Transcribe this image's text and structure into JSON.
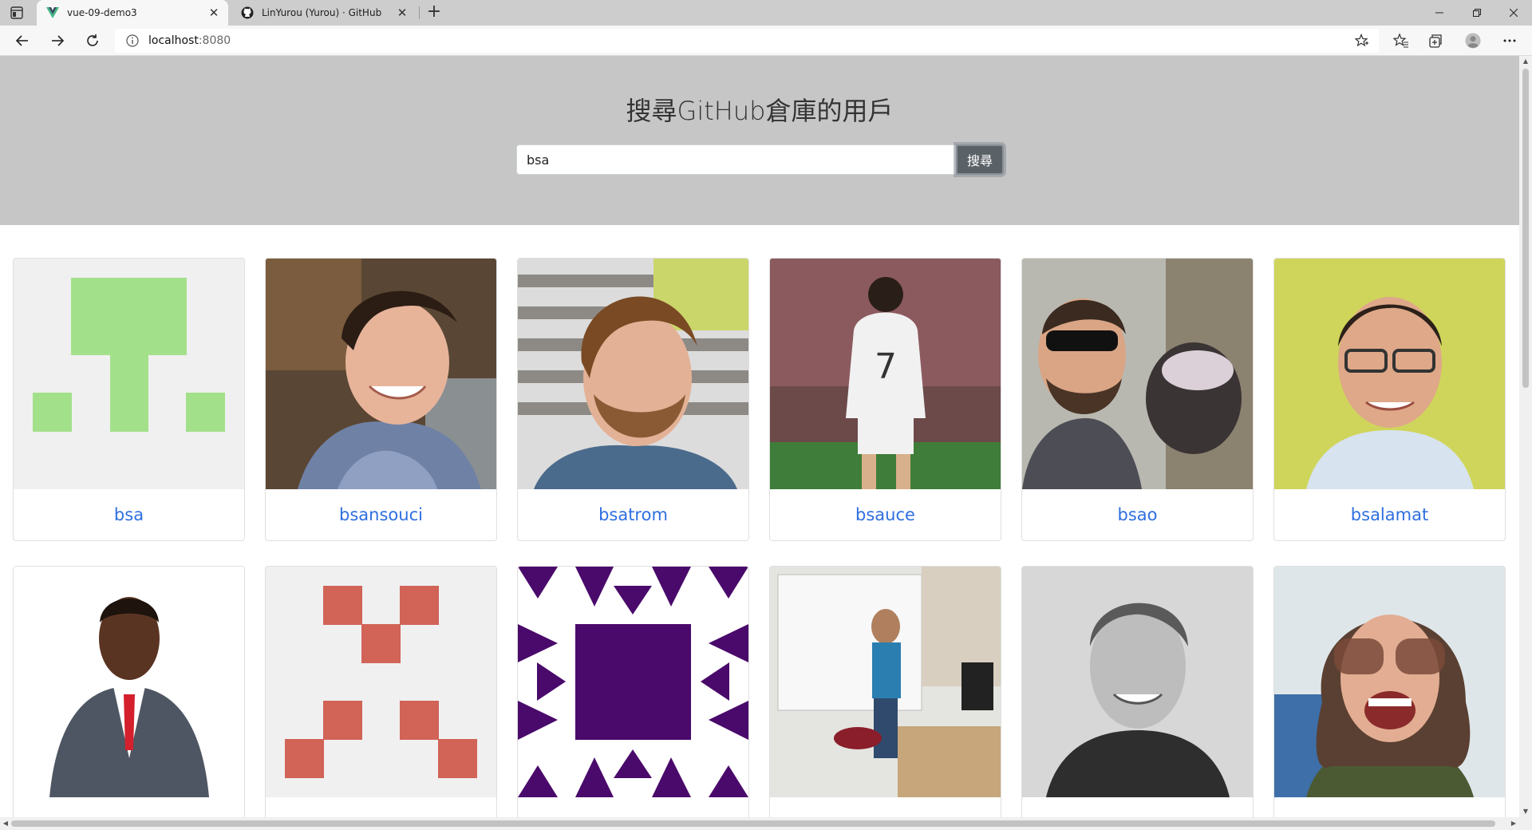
{
  "browser": {
    "tabs": [
      {
        "title": "vue-09-demo3",
        "favicon": "vue-logo-icon",
        "active": true
      },
      {
        "title": "LinYurou (Yurou) · GitHub",
        "favicon": "github-icon",
        "active": false
      }
    ],
    "url_host": "localhost",
    "url_port": ":8080"
  },
  "page": {
    "title": "搜尋GitHub倉庫的用戶",
    "search": {
      "value": "bsa",
      "button_label": "搜尋"
    }
  },
  "users": [
    {
      "login": "bsa",
      "avatar": "identicon-green"
    },
    {
      "login": "bsansouci",
      "avatar": "photo"
    },
    {
      "login": "bsatrom",
      "avatar": "photo"
    },
    {
      "login": "bsauce",
      "avatar": "photo"
    },
    {
      "login": "bsao",
      "avatar": "photo"
    },
    {
      "login": "bsalamat",
      "avatar": "photo"
    },
    {
      "login": "",
      "avatar": "photo"
    },
    {
      "login": "",
      "avatar": "identicon-red"
    },
    {
      "login": "",
      "avatar": "identicon-purple"
    },
    {
      "login": "",
      "avatar": "photo"
    },
    {
      "login": "",
      "avatar": "photo"
    },
    {
      "login": "",
      "avatar": "photo"
    }
  ],
  "colors": {
    "jumbotron": "#c6c6c6",
    "link": "#2f6fe0",
    "button": "#5a6268",
    "identicon_green": "#a3e08a",
    "identicon_red": "#d16357",
    "identicon_purple": "#4a0a6b"
  }
}
